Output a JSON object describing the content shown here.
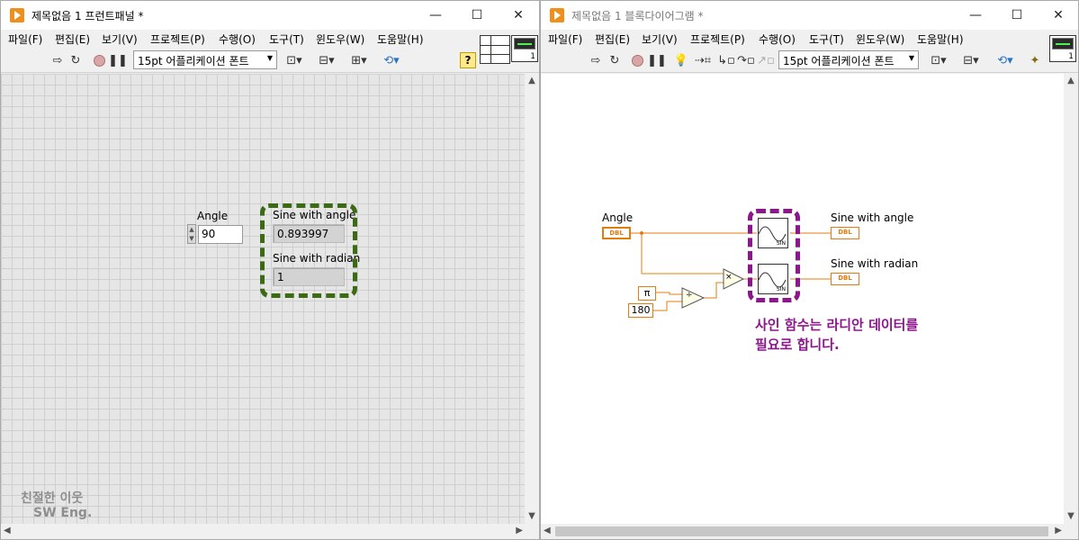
{
  "menu": [
    "파일(F)",
    "편집(E)",
    "보기(V)",
    "프로젝트(P)",
    "수행(O)",
    "도구(T)",
    "윈도우(W)",
    "도움말(H)"
  ],
  "font_selector": "15pt 어플리케이션 폰트",
  "window_controls": {
    "minimize": "—",
    "maximize": "☐",
    "close": "✕"
  },
  "vi_icon_number": "1",
  "front_panel": {
    "title": "제목없음 1 프런트패널 *",
    "help_label": "?",
    "controls": {
      "angle_label": "Angle",
      "angle_value": "90",
      "sine_angle_label": "Sine with angle",
      "sine_angle_value": "0.893997",
      "sine_radian_label": "Sine with radian",
      "sine_radian_value": "1"
    },
    "watermark_line1": "친절한 이웃",
    "watermark_line2": "SW Eng."
  },
  "block_diagram": {
    "title": "제목없음 1 블록다이어그램 *",
    "angle_label": "Angle",
    "terminal_type": "DBL",
    "pi_constant": "π",
    "constant_180": "180",
    "divide_symbol": "÷",
    "multiply_symbol": "×",
    "sin_label": "SIN",
    "sine_angle_label": "Sine with angle",
    "sine_radian_label": "Sine with radian",
    "note_line1": "사인 함수는 라디안 데이터를",
    "note_line2": "필요로 합니다."
  },
  "colors": {
    "wire_orange": "#e37c10",
    "highlight_green": "#3d6b13",
    "highlight_purple": "#8c168c",
    "grid_bg": "#e6e6e6"
  }
}
